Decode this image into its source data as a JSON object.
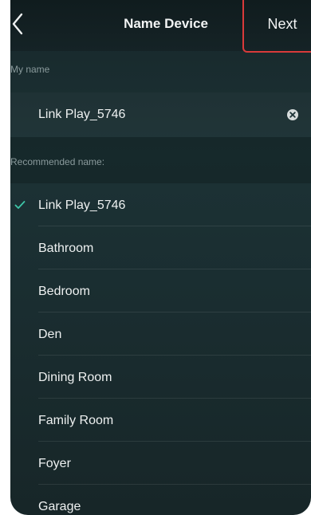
{
  "header": {
    "title": "Name Device",
    "next_label": "Next"
  },
  "my_name": {
    "section_label": "My name",
    "value": "Link Play_5746"
  },
  "recommended": {
    "section_label": "Recommended name:",
    "items": [
      {
        "label": "Link Play_5746",
        "selected": true
      },
      {
        "label": "Bathroom",
        "selected": false
      },
      {
        "label": "Bedroom",
        "selected": false
      },
      {
        "label": "Den",
        "selected": false
      },
      {
        "label": "Dining Room",
        "selected": false
      },
      {
        "label": "Family Room",
        "selected": false
      },
      {
        "label": "Foyer",
        "selected": false
      },
      {
        "label": "Garage",
        "selected": false
      }
    ]
  },
  "colors": {
    "check": "#3ec6a8",
    "highlight": "#d93a3a"
  },
  "icons": {
    "back": "chevron-left-icon",
    "clear": "clear-circle-icon",
    "check": "checkmark-icon"
  }
}
